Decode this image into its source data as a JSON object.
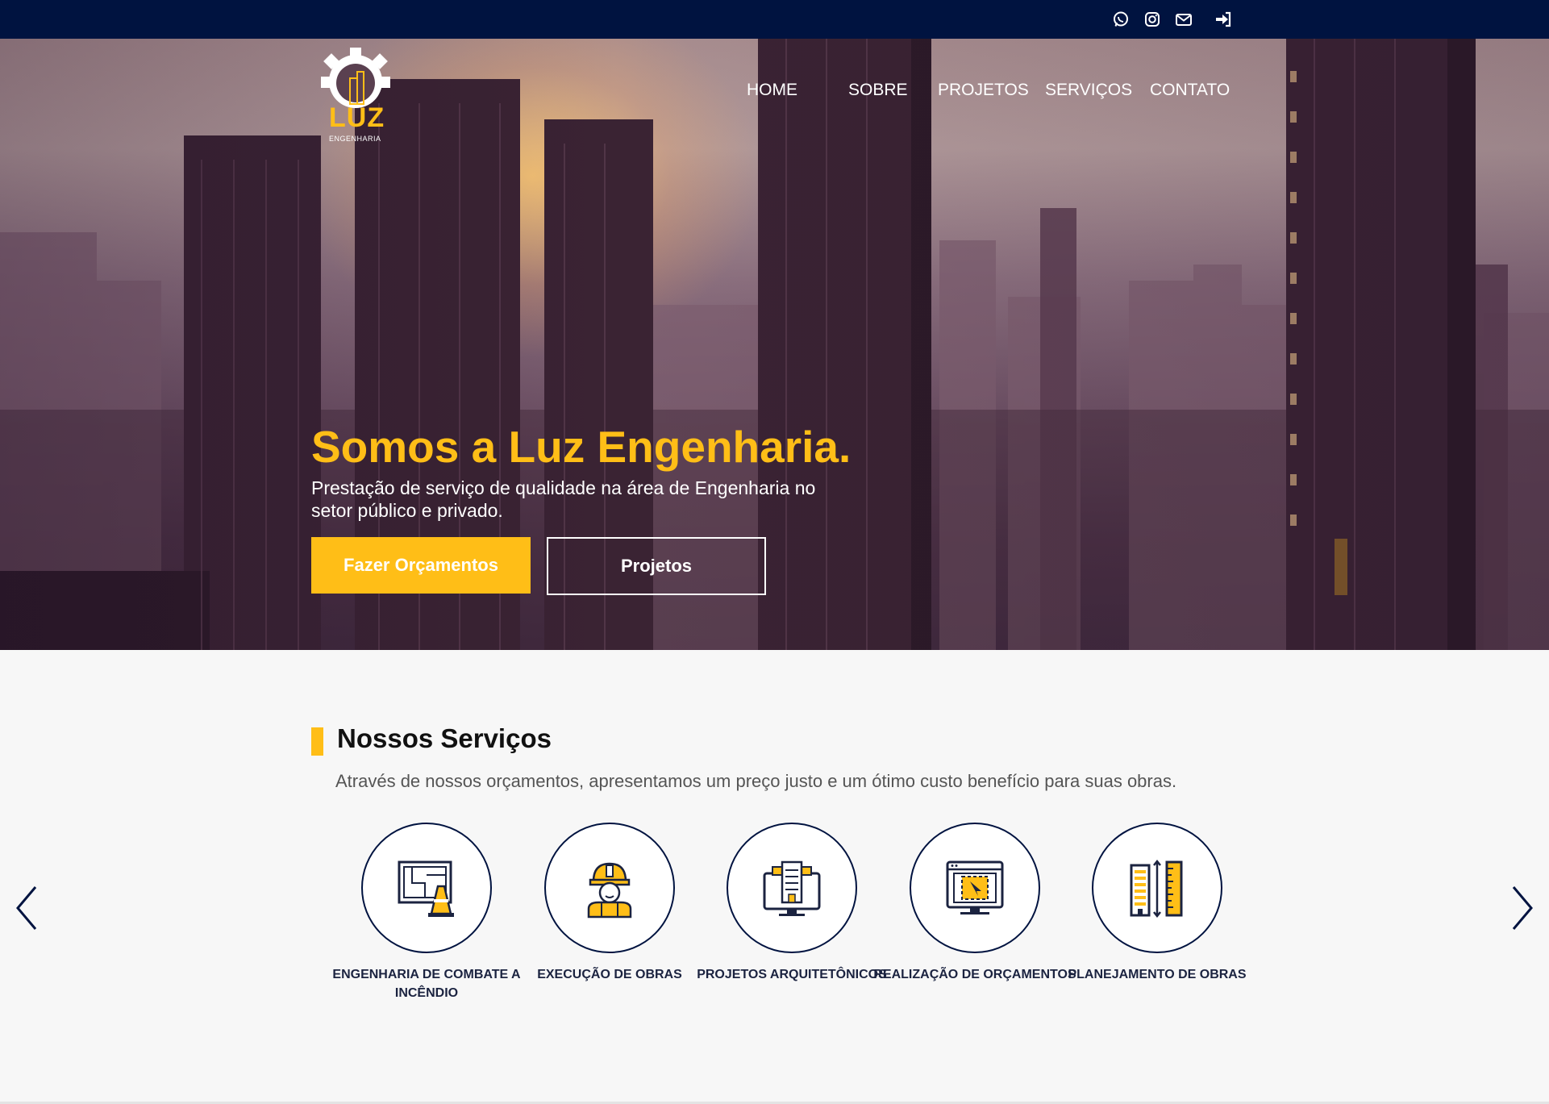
{
  "topbar": {
    "background": "#001340",
    "icons": [
      "whatsapp-icon",
      "instagram-icon",
      "mail-icon",
      "sign-in-icon"
    ]
  },
  "logo": {
    "brand": "LUZ",
    "sub": "ENGENHARIA",
    "icon": "gear-building-icon"
  },
  "nav": {
    "items": [
      "HOME",
      "SOBRE",
      "PROJETOS",
      "SERVIÇOS",
      "CONTATO"
    ]
  },
  "hero": {
    "title": "Somos a Luz Engenharia.",
    "subtitle": "Prestação de serviço de qualidade na área de Engenharia no setor público e privado.",
    "primary_button": "Fazer Orçamentos",
    "secondary_button": "Projetos",
    "accent": "#ffbe17"
  },
  "services": {
    "title": "Nossos Serviços",
    "subtitle": "Através de nossos orçamentos, apresentamos um preço justo e um ótimo custo benefício para suas obras.",
    "items": [
      {
        "label": "ENGENHARIA DE COMBATE A INCÊNDIO",
        "icon": "fire-safety-blueprint-icon"
      },
      {
        "label": "EXECUÇÃO DE OBRAS",
        "icon": "construction-worker-icon"
      },
      {
        "label": "PROJETOS ARQUITETÔNICOS",
        "icon": "architecture-monitor-icon"
      },
      {
        "label": "REALIZAÇÃO DE ORÇAMENTOS",
        "icon": "budget-screen-icon"
      },
      {
        "label": "PLANEJAMENTO DE OBRAS",
        "icon": "building-measure-icon"
      }
    ],
    "prev_icon": "chevron-left-icon",
    "next_icon": "chevron-right-icon"
  }
}
